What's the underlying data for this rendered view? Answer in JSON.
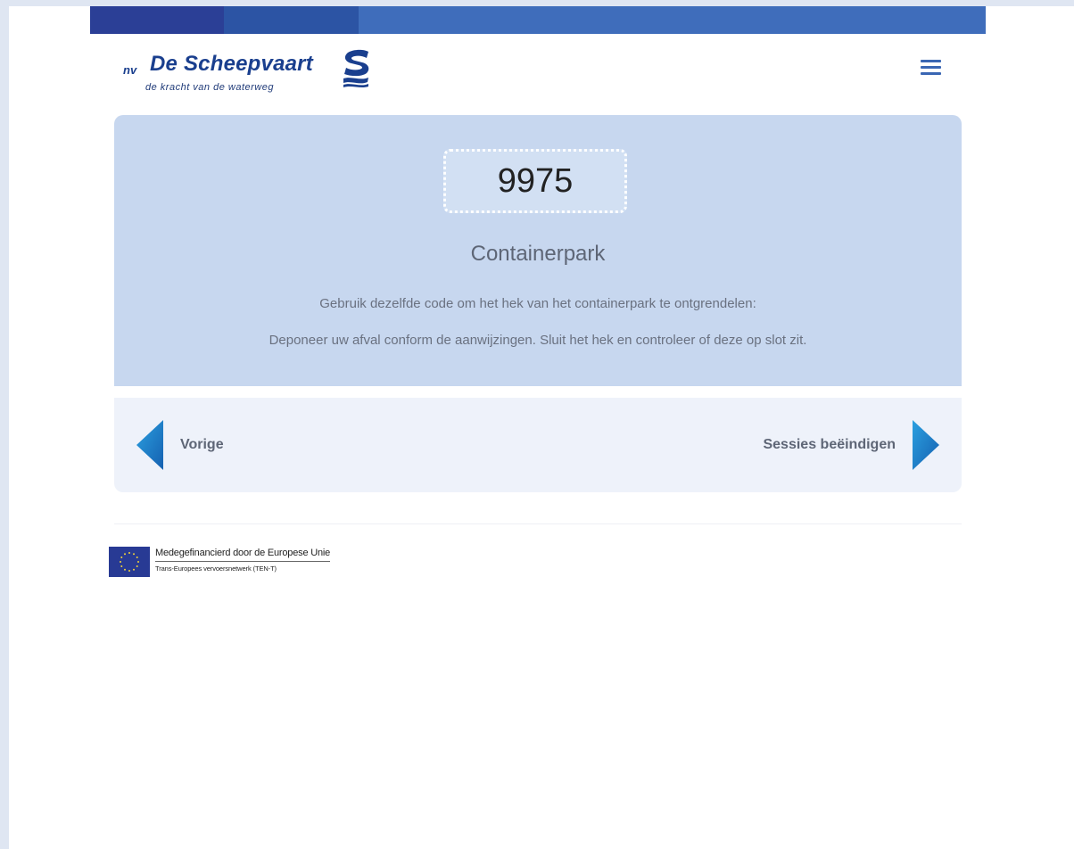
{
  "brand": {
    "prefix": "nv",
    "name": "De Scheepvaart",
    "tagline": "de kracht van de waterweg",
    "logo_icon": "scheepvaart-s-logo-icon",
    "colors": {
      "primary": "#1a3f8e",
      "stripe_dark": "#2b3f96",
      "stripe_mid": "#2c54a4",
      "stripe_light": "#3f6dbb",
      "card_background": "#c7d7ef",
      "nav_background": "#eef2fa",
      "arrow_blue": "#1e7cc8"
    }
  },
  "header": {
    "menu_icon": "hamburger-menu-icon"
  },
  "card": {
    "code": "9975",
    "title": "Containerpark",
    "line1": "Gebruik dezelfde code om het hek van het containerpark te ontgrendelen:",
    "line2": "Deponeer uw afval conform de aanwijzingen. Sluit het hek en controleer of deze op slot zit."
  },
  "navigation": {
    "prev_label": "Vorige",
    "prev_icon": "arrow-left-icon",
    "next_label": "Sessies beëindigen",
    "next_icon": "arrow-right-icon"
  },
  "footer": {
    "eu_flag_icon": "eu-flag-icon",
    "eu_main": "Medegefinancierd door de Europese Unie",
    "eu_sub": "Trans-Europees vervoersnetwerk (TEN-T)"
  }
}
